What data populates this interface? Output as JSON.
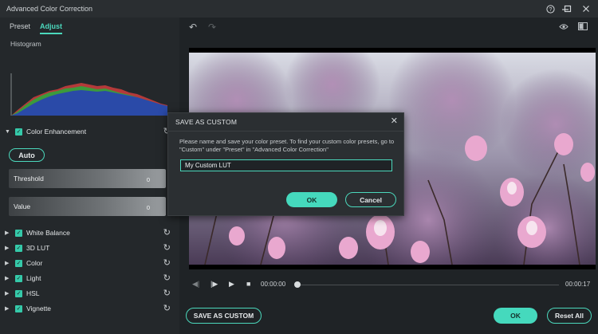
{
  "window": {
    "title": "Advanced Color Correction"
  },
  "tabs": [
    {
      "label": "Preset"
    },
    {
      "label": "Adjust"
    }
  ],
  "histogram": {
    "label": "Histogram"
  },
  "color_enhancement": {
    "label": "Color Enhancement",
    "auto_label": "Auto",
    "threshold": {
      "label": "Threshold",
      "value": "0"
    },
    "value": {
      "label": "Value",
      "value": "0"
    }
  },
  "sections": [
    {
      "label": "White Balance"
    },
    {
      "label": "3D LUT"
    },
    {
      "label": "Color"
    },
    {
      "label": "Light"
    },
    {
      "label": "HSL"
    },
    {
      "label": "Vignette"
    }
  ],
  "player": {
    "current_time": "00:00:00",
    "duration": "00:00:17",
    "progress": 0.0
  },
  "buttons": {
    "save_as_custom": "SAVE AS CUSTOM",
    "ok": "OK",
    "reset_all": "Reset All"
  },
  "dialog": {
    "title": "SAVE AS CUSTOM",
    "description": "Please name and save your color preset. To find your custom color presets, go to \"Custom\" under \"Preset\" in \"Advanced Color Correction\"",
    "input_value": "My Custom LUT",
    "ok": "OK",
    "cancel": "Cancel"
  },
  "colors": {
    "accent": "#45d9bd",
    "background": "#1f2326"
  }
}
